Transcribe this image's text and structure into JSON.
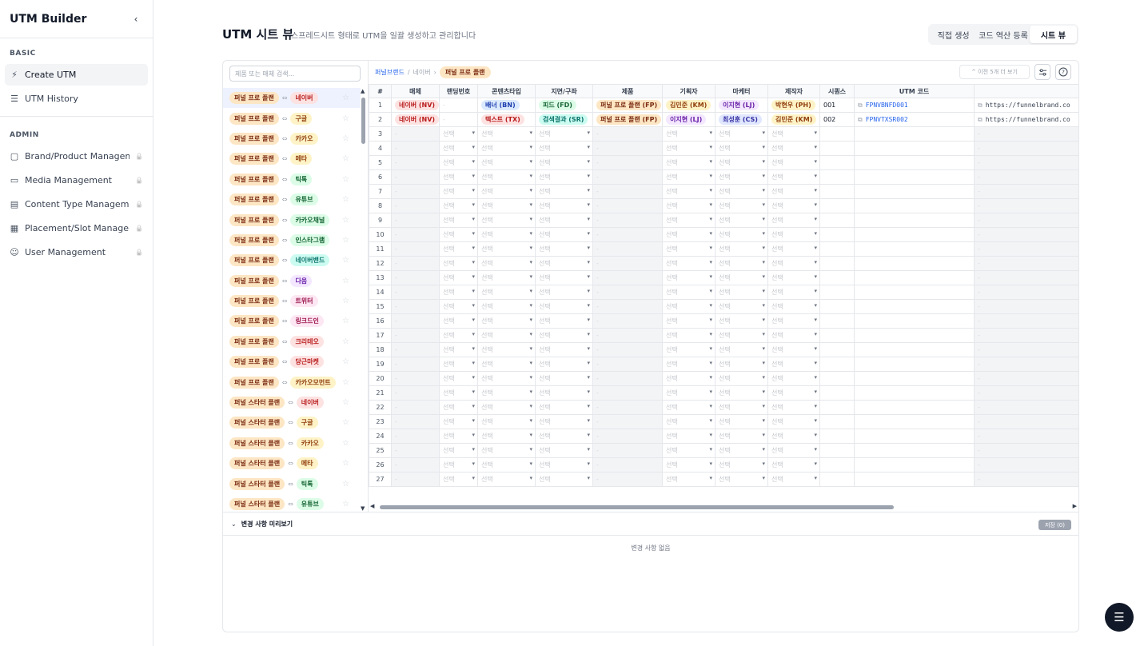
{
  "sidebar": {
    "title": "UTM Builder",
    "collapse_icon": "chevron-left-icon",
    "section_basic": "BASIC",
    "basic_items": [
      {
        "label": "Create UTM",
        "icon": "lightning-icon",
        "active": true
      },
      {
        "label": "UTM History",
        "icon": "list-icon",
        "active": false
      }
    ],
    "section_admin": "ADMIN",
    "admin_items": [
      {
        "label": "Brand/Product Management",
        "icon": "box-icon"
      },
      {
        "label": "Media Management",
        "icon": "monitor-icon"
      },
      {
        "label": "Content Type Management",
        "icon": "document-icon"
      },
      {
        "label": "Placement/Slot Management",
        "icon": "grid-icon"
      },
      {
        "label": "User Management",
        "icon": "users-icon"
      }
    ]
  },
  "header": {
    "title": "UTM 시트 뷰",
    "subtitle": "스프레드시트 형태로 UTM을 일괄 생성하고 관리합니다",
    "tabs": [
      {
        "label": "직접 생성",
        "active": false
      },
      {
        "label": "코드 역산 등록",
        "active": false
      },
      {
        "label": "시트 뷰",
        "active": true
      }
    ]
  },
  "left_panel": {
    "search_placeholder": "제품 또는 매체 검색...",
    "rows": [
      {
        "brand": "퍼널 프로 플랜",
        "media": "네이버",
        "color": "red"
      },
      {
        "brand": "퍼널 프로 플랜",
        "media": "구글",
        "color": "amber"
      },
      {
        "brand": "퍼널 프로 플랜",
        "media": "카카오",
        "color": "amber"
      },
      {
        "brand": "퍼널 프로 플랜",
        "media": "메타",
        "color": "amber"
      },
      {
        "brand": "퍼널 프로 플랜",
        "media": "틱톡",
        "color": "green"
      },
      {
        "brand": "퍼널 프로 플랜",
        "media": "유튜브",
        "color": "green"
      },
      {
        "brand": "퍼널 프로 플랜",
        "media": "카카오채널",
        "color": "green"
      },
      {
        "brand": "퍼널 프로 플랜",
        "media": "인스타그램",
        "color": "green"
      },
      {
        "brand": "퍼널 프로 플랜",
        "media": "네이버밴드",
        "color": "teal"
      },
      {
        "brand": "퍼널 프로 플랜",
        "media": "다음",
        "color": "purple"
      },
      {
        "brand": "퍼널 프로 플랜",
        "media": "트위터",
        "color": "pink"
      },
      {
        "brand": "퍼널 프로 플랜",
        "media": "링크드인",
        "color": "pink"
      },
      {
        "brand": "퍼널 프로 플랜",
        "media": "크리테오",
        "color": "red"
      },
      {
        "brand": "퍼널 프로 플랜",
        "media": "당근마켓",
        "color": "red"
      },
      {
        "brand": "퍼널 프로 플랜",
        "media": "카카오모먼트",
        "color": "amber"
      },
      {
        "brand": "퍼널 스타터 플랜",
        "media": "네이버",
        "color": "red"
      },
      {
        "brand": "퍼널 스타터 플랜",
        "media": "구글",
        "color": "amber"
      },
      {
        "brand": "퍼널 스타터 플랜",
        "media": "카카오",
        "color": "amber"
      },
      {
        "brand": "퍼널 스타터 플랜",
        "media": "메타",
        "color": "amber"
      },
      {
        "brand": "퍼널 스타터 플랜",
        "media": "틱톡",
        "color": "green"
      },
      {
        "brand": "퍼널 스타터 플랜",
        "media": "유튜브",
        "color": "green"
      }
    ]
  },
  "breadcrumb": {
    "level1": "퍼널브랜드",
    "sep1": "/",
    "level2": "네이버",
    "sep2": "›",
    "current": "퍼널 프로 플랜"
  },
  "toolbar": {
    "prev_label": "^ 이전 5개 더 보기",
    "settings_icon": "sliders-icon",
    "help_icon": "help-circle-icon"
  },
  "sheet": {
    "columns": [
      "#",
      "매체",
      "랜딩번호",
      "콘텐츠타입",
      "지면/구좌",
      "제품",
      "기획자",
      "마케터",
      "제작자",
      "시퀀스",
      "UTM 코드",
      ""
    ],
    "rows": [
      {
        "num": "1",
        "media": "네이버 (NV)",
        "landing": "-",
        "content_type": "배너 (BN)",
        "placement": "피드 (FD)",
        "product": "퍼널 프로 플랜 (FP)",
        "planner": "김민준 (KM)",
        "marketer": "이지현 (LJ)",
        "producer": "박현우 (PH)",
        "sequence": "001",
        "utm_code": "FPNVBNFD001",
        "url": "https://funnelbrand.co"
      },
      {
        "num": "2",
        "media": "네이버 (NV)",
        "landing": "-",
        "content_type": "텍스트 (TX)",
        "placement": "검색결과 (SR)",
        "product": "퍼널 프로 플랜 (FP)",
        "planner": "이지현 (LJ)",
        "marketer": "최성훈 (CS)",
        "producer": "김민준 (KM)",
        "sequence": "002",
        "utm_code": "FPNVTXSR002",
        "url": "https://funnelbrand.co"
      }
    ],
    "empty_row_numbers": [
      "3",
      "4",
      "5",
      "6",
      "7",
      "8",
      "9",
      "10",
      "11",
      "12",
      "13",
      "14",
      "15",
      "16",
      "17",
      "18",
      "19",
      "20",
      "21",
      "22",
      "23",
      "24",
      "25",
      "26",
      "27"
    ],
    "empty_dash": "-",
    "select_placeholder": "선택"
  },
  "changes": {
    "label": "변경 사항 미리보기",
    "save_label": "저장 (0)",
    "empty_text": "변경 사항 없음"
  },
  "fab": {
    "icon": "menu-icon"
  }
}
